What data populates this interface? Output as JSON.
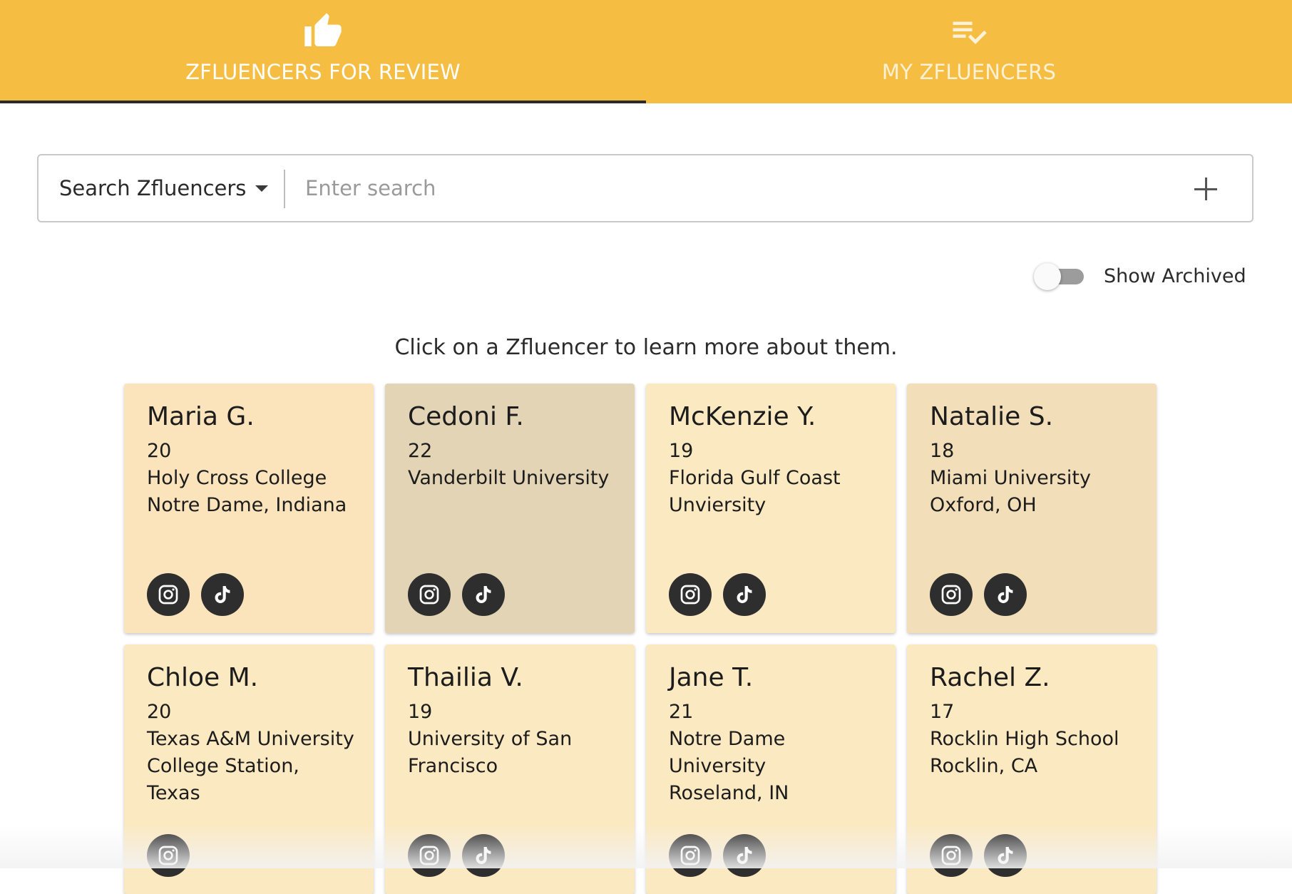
{
  "tabs": [
    {
      "label": "ZFLUENCERS FOR REVIEW",
      "icon": "thumbs-up-icon",
      "active": true
    },
    {
      "label": "MY ZFLUENCERS",
      "icon": "playlist-check-icon",
      "active": false
    }
  ],
  "search": {
    "selector_label": "Search Zfluencers",
    "placeholder": "Enter search",
    "value": ""
  },
  "archived_toggle": {
    "label": "Show Archived",
    "on": false
  },
  "instruction": "Click on a Zfluencer to learn more about them.",
  "cards": [
    {
      "name": "Maria G.",
      "lines": [
        "20",
        "Holy Cross College",
        "Notre Dame, Indiana"
      ],
      "socials": [
        "instagram-icon",
        "tiktok-icon"
      ]
    },
    {
      "name": "Cedoni F.",
      "lines": [
        "22",
        "Vanderbilt University"
      ],
      "socials": [
        "instagram-icon",
        "tiktok-icon"
      ]
    },
    {
      "name": "McKenzie Y.",
      "lines": [
        "19",
        "Florida Gulf Coast",
        "Unviersity"
      ],
      "socials": [
        "instagram-icon",
        "tiktok-icon"
      ]
    },
    {
      "name": "Natalie S.",
      "lines": [
        "18",
        "Miami University",
        "Oxford, OH"
      ],
      "socials": [
        "instagram-icon",
        "tiktok-icon"
      ]
    },
    {
      "name": "Chloe M.",
      "lines": [
        "20",
        "Texas A&M University",
        "College Station,",
        "Texas"
      ],
      "socials": [
        "instagram-icon"
      ]
    },
    {
      "name": "Thailia V.",
      "lines": [
        "19",
        "University of San",
        "Francisco"
      ],
      "socials": [
        "instagram-icon",
        "tiktok-icon"
      ]
    },
    {
      "name": "Jane T.",
      "lines": [
        "21",
        "Notre Dame",
        "University",
        "Roseland, IN"
      ],
      "socials": [
        "instagram-icon",
        "tiktok-icon"
      ]
    },
    {
      "name": "Rachel Z.",
      "lines": [
        "17",
        "Rocklin High School",
        "Rocklin, CA"
      ],
      "socials": [
        "instagram-icon",
        "tiktok-icon"
      ]
    }
  ],
  "colors": {
    "header": "#f5bd41",
    "card": "#fbe9c2",
    "card_hover": "#e2d4b4",
    "icon_circle": "#2e2e2e"
  }
}
